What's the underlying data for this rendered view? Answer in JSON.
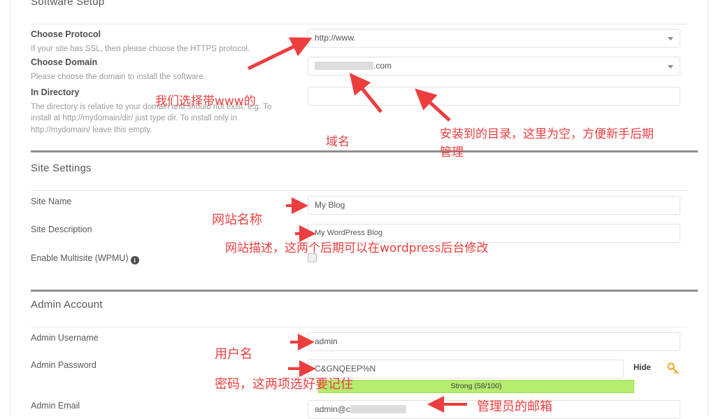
{
  "sections": [
    {
      "id": "software-setup",
      "title": "Software Setup",
      "rows": [
        {
          "label": "Choose Protocol",
          "help": "If your site has SSL, then please choose the HTTPS protocol.",
          "control": "select",
          "value": "http://www."
        },
        {
          "label": "Choose Domain",
          "help": "Please choose the domain to install the software.",
          "control": "select",
          "value": ".com",
          "redacted": true
        },
        {
          "label": "In Directory",
          "help": "The directory is relative to your domain and should not exist. e.g. To install at http://mydomain/dir/ just type dir. To install only in http://mydomain/ leave this empty.",
          "help_bold": "dir",
          "control": "text",
          "value": ""
        }
      ]
    },
    {
      "id": "site-settings",
      "title": "Site Settings",
      "rows": [
        {
          "label": "Site Name",
          "control": "text",
          "value": "My Blog"
        },
        {
          "label": "Site Description",
          "control": "text",
          "value": "My WordPress Blog"
        },
        {
          "label": "Enable Multisite (WPMU)",
          "control": "checkbox",
          "info": "i",
          "checked": false
        }
      ]
    },
    {
      "id": "admin-account",
      "title": "Admin Account",
      "rows": [
        {
          "label": "Admin Username",
          "control": "text",
          "value": "admin"
        },
        {
          "label": "Admin Password",
          "control": "password",
          "value": "C&GNQEEP%N",
          "hide_label": "Hide",
          "strength_text": "Strong (58/100)",
          "strength_color": "#b4ec6d"
        },
        {
          "label": "Admin Email",
          "control": "text",
          "value": "admin@c",
          "redacted": true
        }
      ]
    }
  ],
  "annotations": [
    {
      "id": "anno-www",
      "text": "我们选择带www的"
    },
    {
      "id": "anno-domain",
      "text": "域名"
    },
    {
      "id": "anno-directory-1",
      "text": "安装到的目录，这里为空，方便新手后期"
    },
    {
      "id": "anno-directory-2",
      "text": "管理"
    },
    {
      "id": "anno-sitename",
      "text": "网站名称"
    },
    {
      "id": "anno-sitedesc",
      "text": "网站描述，这两个后期可以在wordpress后台修改"
    },
    {
      "id": "anno-username",
      "text": "用户名"
    },
    {
      "id": "anno-password",
      "text": "密码，这两项选好要记住"
    },
    {
      "id": "anno-email",
      "text": "管理员的邮箱"
    }
  ],
  "colors": {
    "annotation_red": "#ec3e3e",
    "strength_green": "#b4ec6d",
    "divider_gray": "#8d8d8d",
    "key_icon_orange": "#f0a623"
  }
}
